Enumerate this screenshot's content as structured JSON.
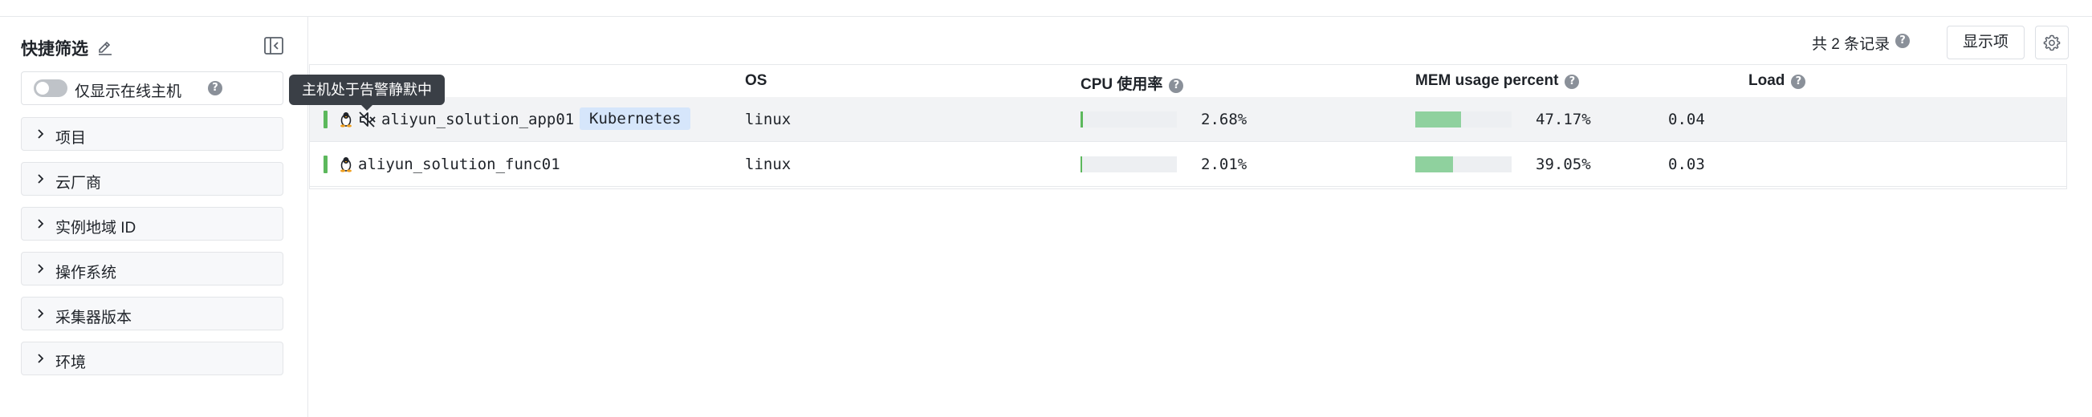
{
  "sidebar": {
    "title": "快捷筛选",
    "online_only_label": "仅显示在线主机",
    "groups": [
      {
        "label": "项目"
      },
      {
        "label": "云厂商"
      },
      {
        "label": "实例地域 ID"
      },
      {
        "label": "操作系统"
      },
      {
        "label": "采集器版本"
      },
      {
        "label": "环境"
      }
    ]
  },
  "toolbar": {
    "record_count": "共 2 条记录",
    "display_button": "显示项"
  },
  "table": {
    "columns": [
      "OS",
      "CPU 使用率",
      "MEM usage percent",
      "Load"
    ],
    "rows": [
      {
        "hostname": "aliyun_solution_app01",
        "tag": "Kubernetes",
        "muted": true,
        "os": "linux",
        "cpu": "2.68%",
        "cpu_value": 2.68,
        "mem": "47.17%",
        "mem_value": 47.17,
        "load": "0.04"
      },
      {
        "hostname": "aliyun_solution_func01",
        "tag": "",
        "muted": false,
        "os": "linux",
        "cpu": "2.01%",
        "cpu_value": 2.01,
        "mem": "39.05%",
        "mem_value": 39.05,
        "load": "0.03"
      }
    ]
  },
  "tooltip": {
    "text": "主机处于告警静默中"
  },
  "colors": {
    "status_online": "#5cb85c",
    "cpu_bar": "#5cb85c",
    "mem_bar": "#8fd19e",
    "tag_bg": "#d6e6fb"
  }
}
